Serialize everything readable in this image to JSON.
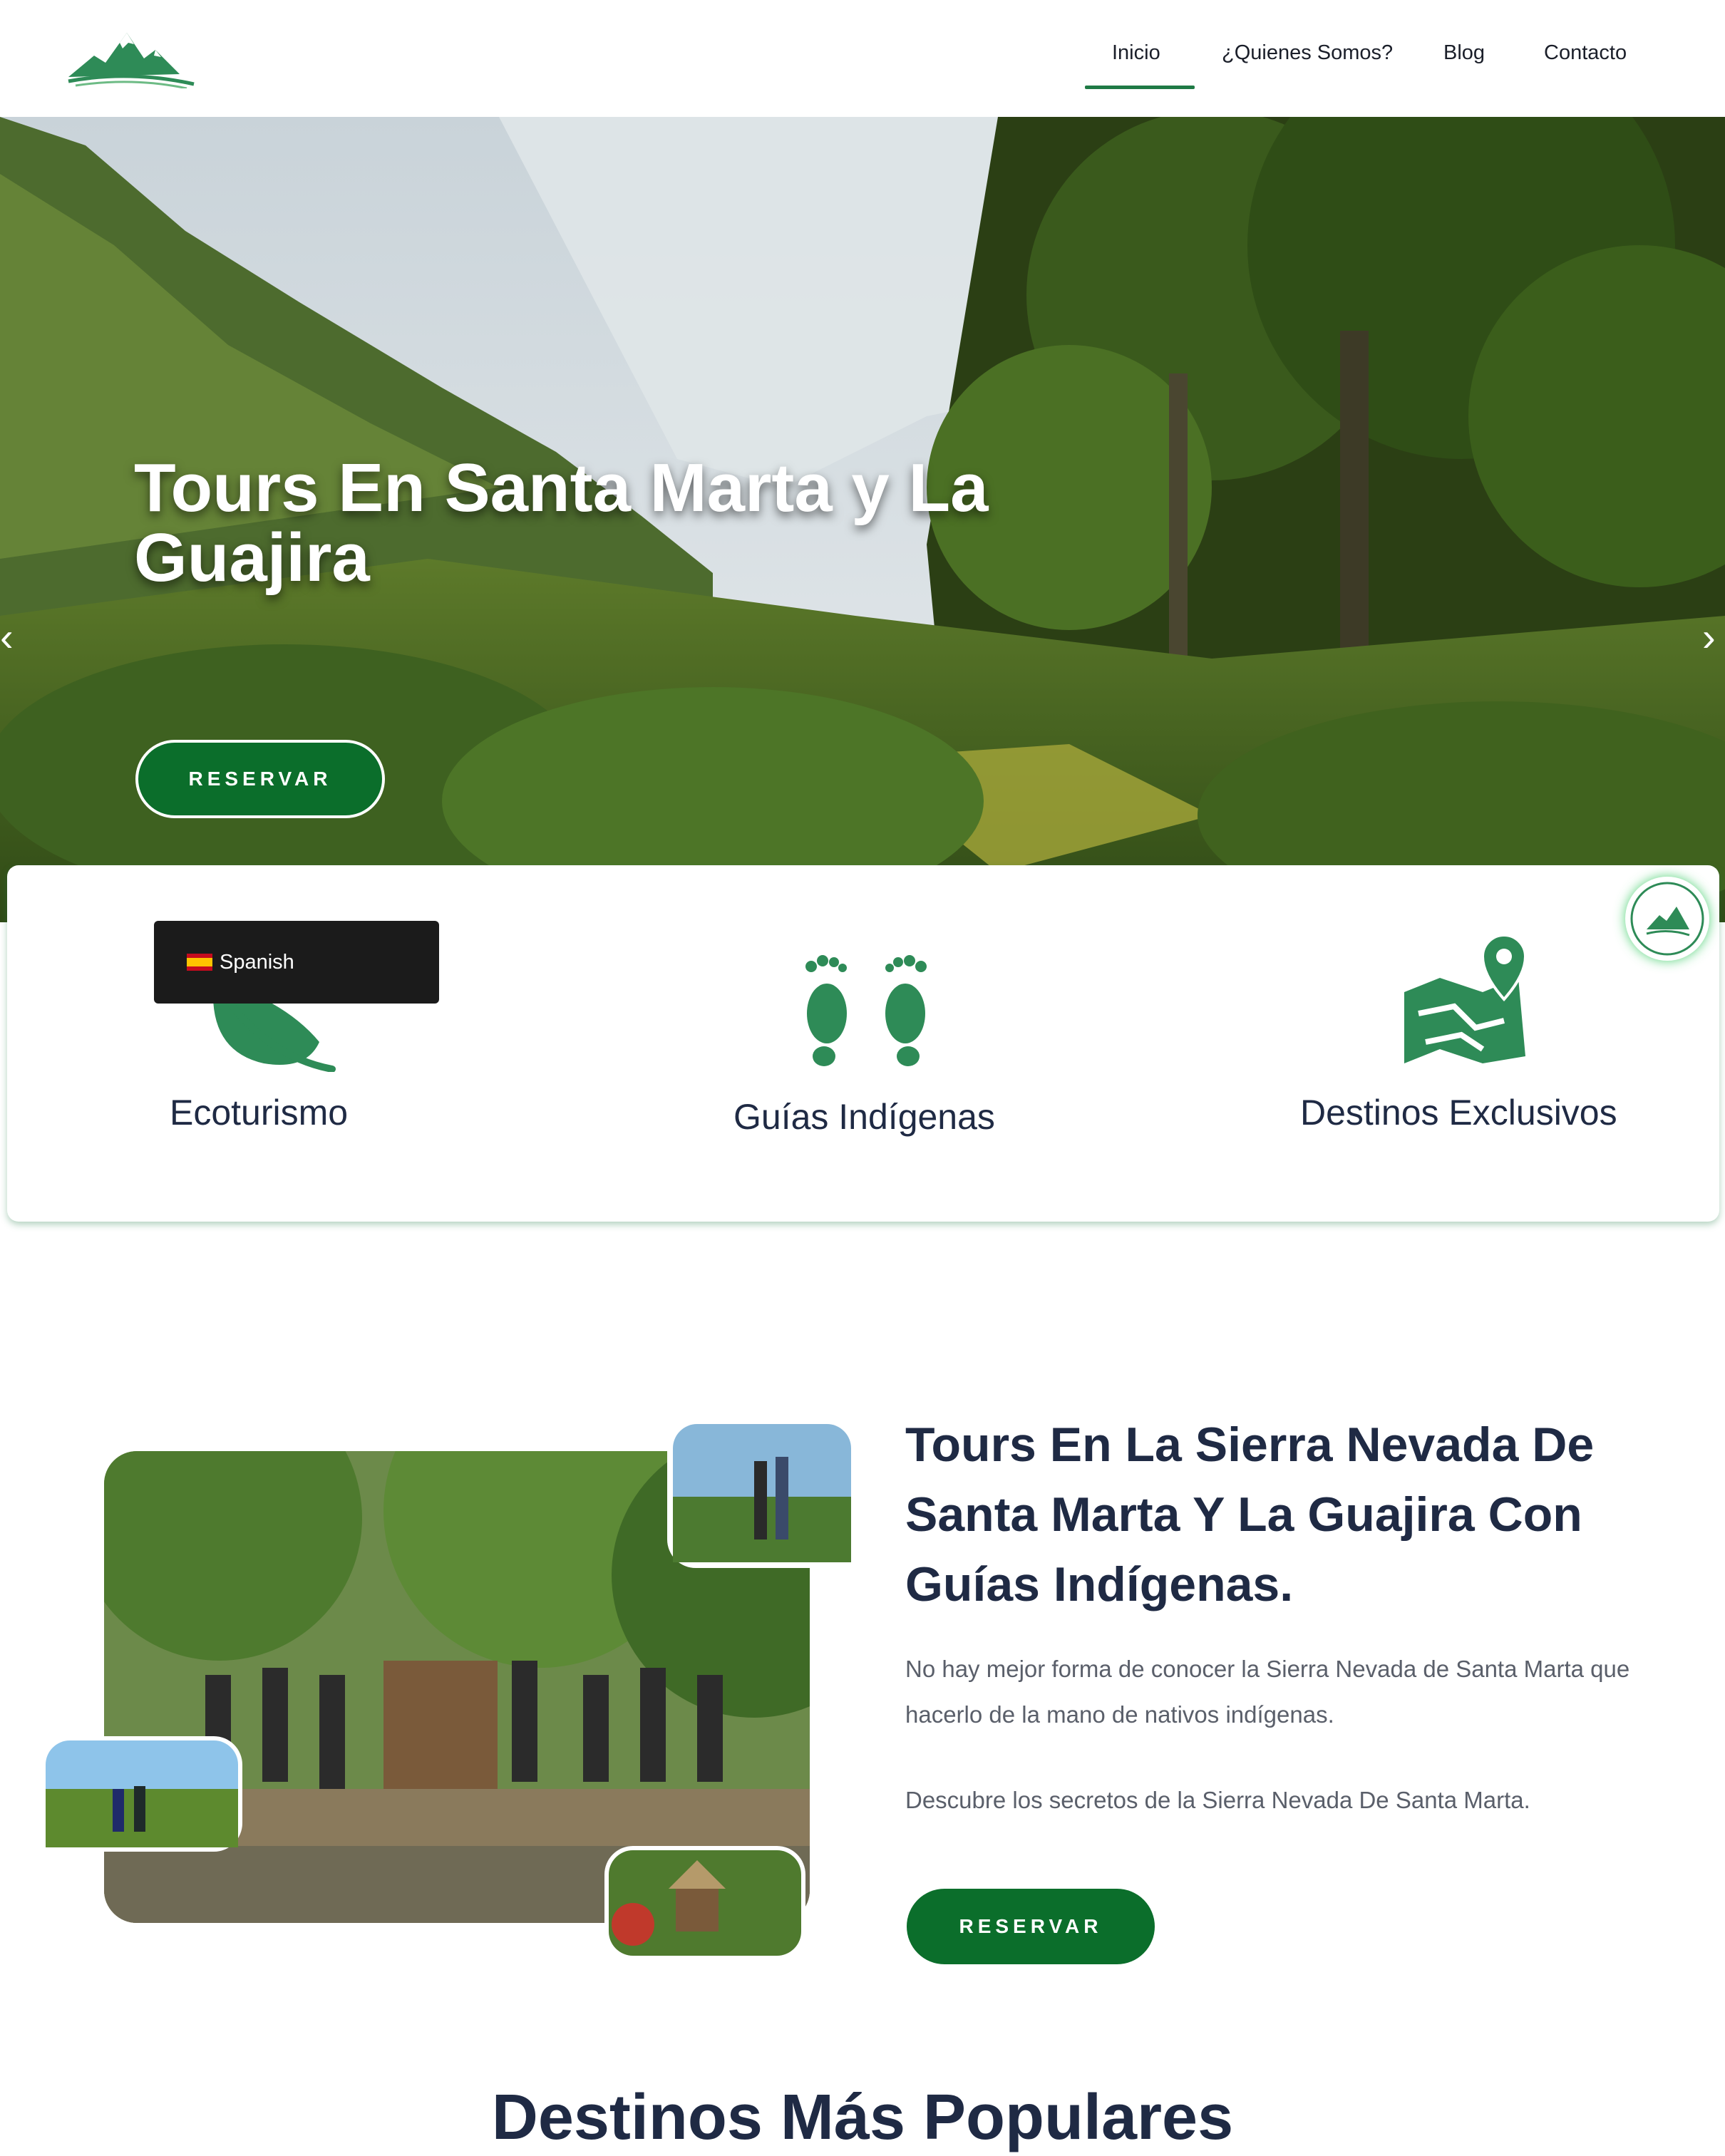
{
  "header": {
    "nav": [
      {
        "label": "Inicio",
        "active": true
      },
      {
        "label": "¿Quienes Somos?"
      },
      {
        "label": "Blog"
      },
      {
        "label": "Contacto"
      }
    ]
  },
  "hero": {
    "title": "Tours En Santa Marta y La Guajira",
    "button": "RESERVAR",
    "prev_icon": "chevron-left-icon",
    "next_icon": "chevron-right-icon"
  },
  "features": [
    {
      "label": "Ecoturismo",
      "icon": "leaf-icon"
    },
    {
      "label": "Guías Indígenas",
      "icon": "footprints-icon"
    },
    {
      "label": "Destinos Exclusivos",
      "icon": "map-pin-icon"
    }
  ],
  "language": {
    "label": "Spanish",
    "flag": "spain-flag-icon"
  },
  "about": {
    "title": "Tours En La Sierra Nevada De Santa Marta Y La Guajira Con Guías Indígenas.",
    "paragraph1": "No hay mejor forma de conocer la Sierra Nevada de Santa Marta que hacerlo de la mano de nativos indígenas.",
    "paragraph2": "Descubre los secretos de la Sierra Nevada De Santa Marta.",
    "button": "RESERVAR"
  },
  "popular": {
    "title": "Destinos Más Populares"
  },
  "colors": {
    "brand_green": "#0b6e2b",
    "accent_green": "#1f7a45",
    "icon_green": "#2e8b57",
    "text_dark": "#1f2a44"
  }
}
